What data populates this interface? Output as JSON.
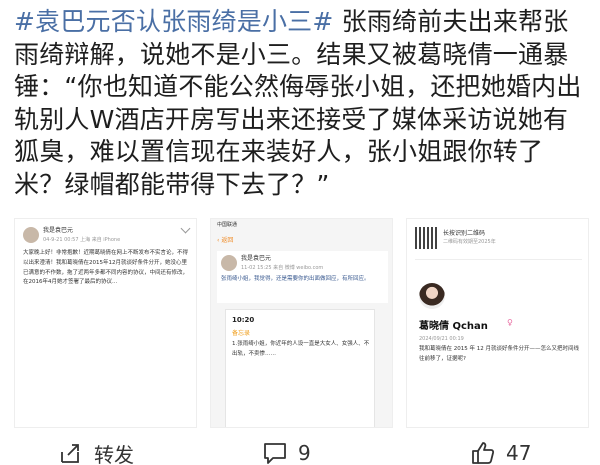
{
  "post": {
    "hashtag": "#袁巴元否认张雨绮是小三#",
    "body": " 张雨绮前夫出来帮张雨绮辩解，说她不是小三。结果又被葛晓倩一通暴锤：“你也知道不能公然侮辱张小姐，还把她婚内出轨别人W酒店开房写出来还接受了媒体采访说她有狐臭，难以置信现在来装好人，张小姐跟你转了米？绿帽都能带得下去了？”"
  },
  "images": {
    "thumb1": {
      "username": "我是袁巴元",
      "meta": "04-9-21 00:57  上海 来自 iPhone",
      "body": "大家晚上好！非常抱歉！近期葛晓倩在网上不断发布不实言论，不得以出来澄清！我和葛晓倩在2015年12月就谈好条件分开，她没心里已满意的不作数，拖了近两年多都不同内容的协议，中间还有修改，在2016年4月她才签署了最后的协议..."
    },
    "thumb2": {
      "carrier": "中国联通",
      "back": "返回",
      "username": "我是袁巴元",
      "meta": "11-02 15:25 来自 微博 weibo.com",
      "card_body": "张雨绮小姐，我觉得，还是需要你的出面做回应，有所回应。",
      "notes_time": "10:20",
      "notes_back": "备忘录",
      "notes_body": "1.张雨绮小姐，你近年的人设一直是大女人、女强人、不出轨，不卖惨……"
    },
    "thumb3": {
      "qr_label": "长按识别二维码",
      "qr_sub": "二维码有效期至2025年",
      "name": "葛晓倩 Qchan",
      "gender": "♀",
      "date": "2024/09/21 00:19",
      "body": "我和葛晓倩在 2015 年 12 月就谈好条件分开——怎么又把时间线往前移了，证据呢?"
    }
  },
  "actions": {
    "share_label": "转发",
    "comment_count": "9",
    "like_count": "47"
  }
}
